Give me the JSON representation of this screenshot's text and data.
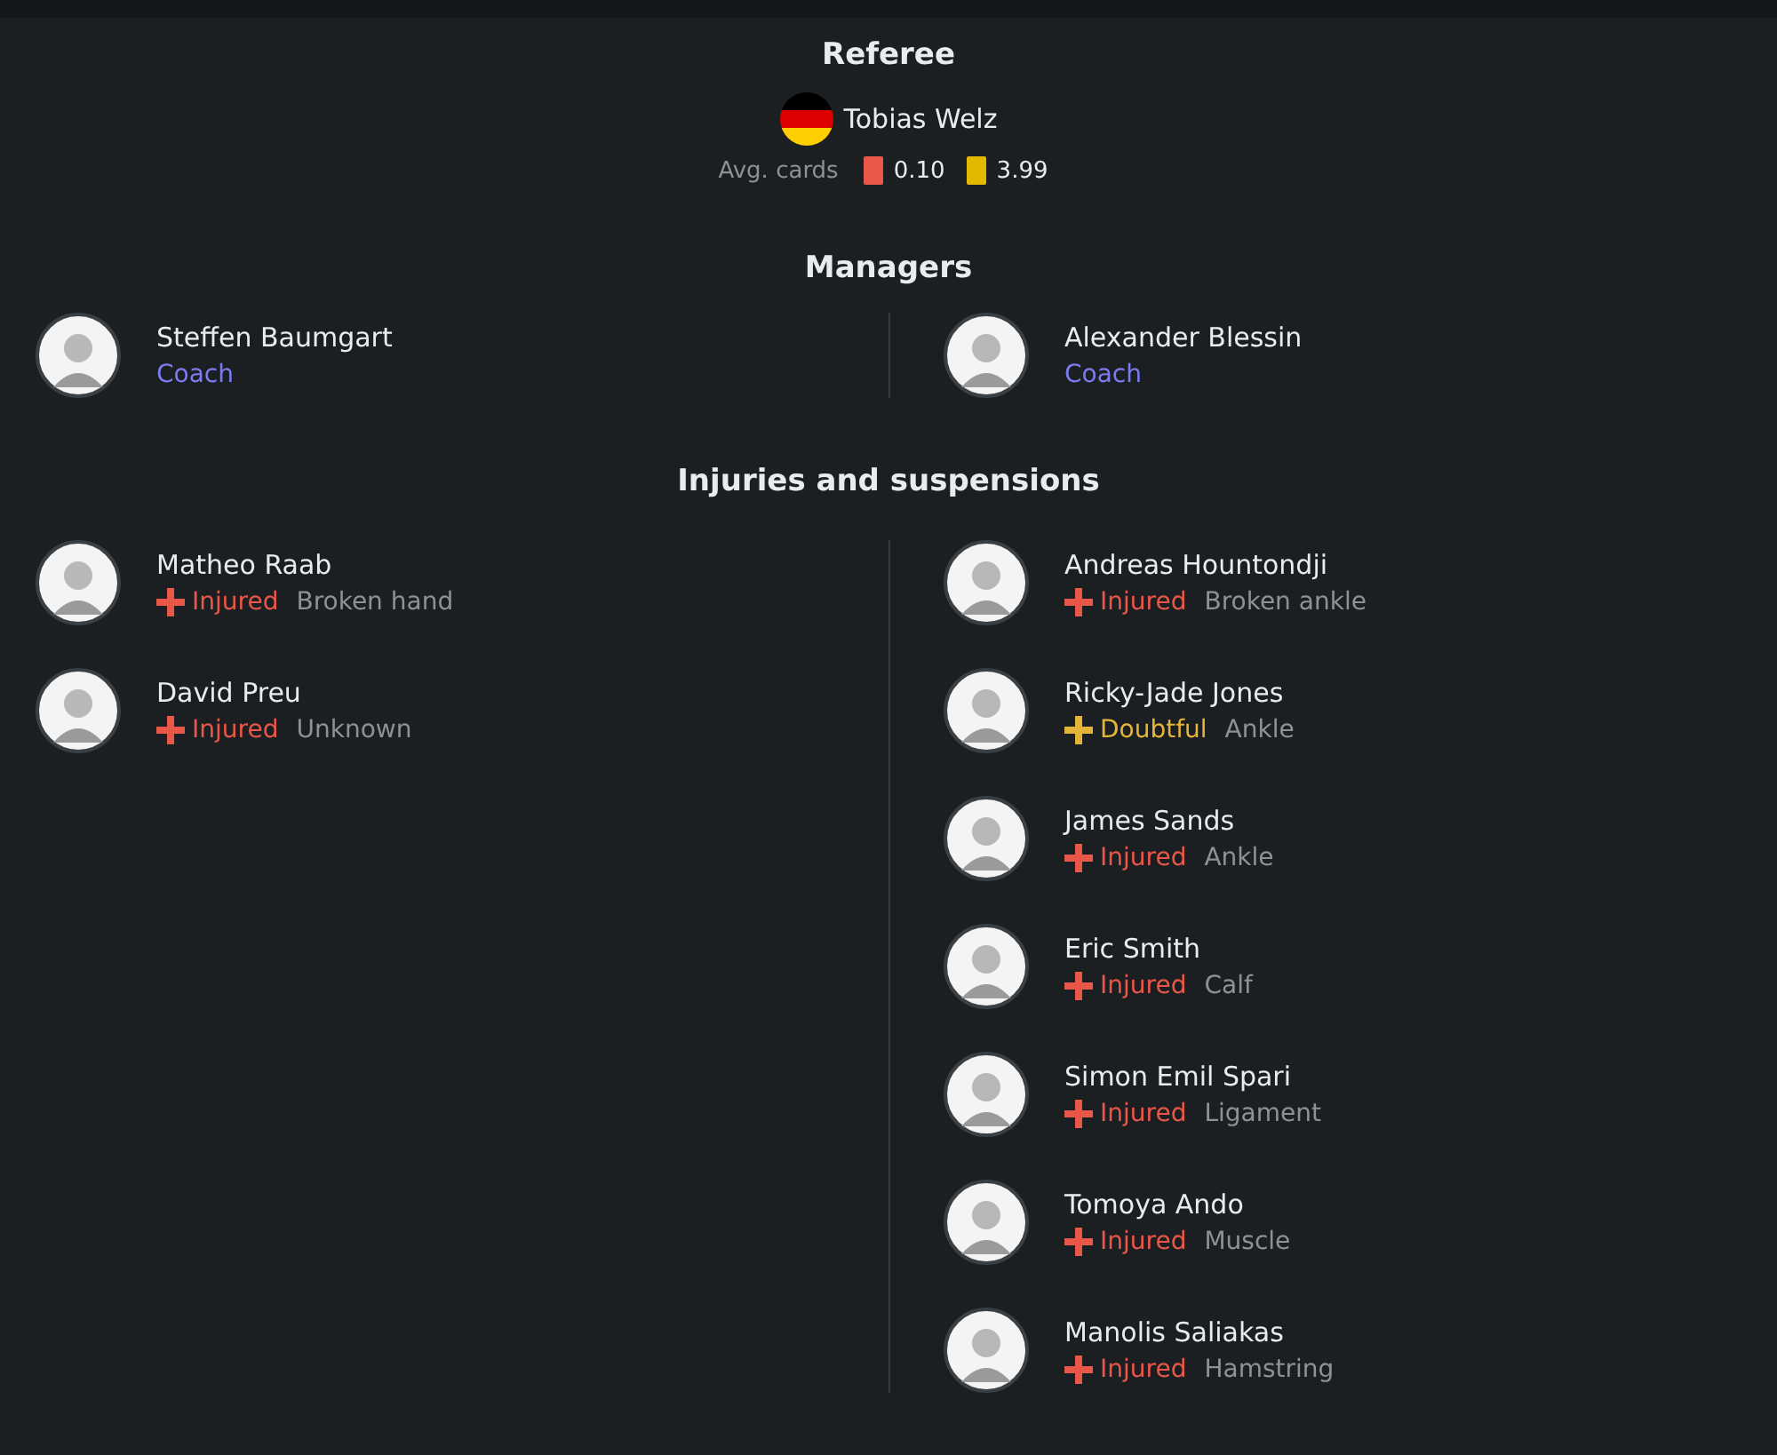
{
  "referee": {
    "title": "Referee",
    "name": "Tobias Welz",
    "avg_label": "Avg. cards",
    "red_cards": "0.10",
    "yellow_cards": "3.99"
  },
  "managers": {
    "title": "Managers",
    "items": [
      {
        "name": "Steffen Baumgart",
        "role": "Coach"
      },
      {
        "name": "Alexander Blessin",
        "role": "Coach"
      }
    ]
  },
  "injuries": {
    "title": "Injuries and suspensions",
    "columns": [
      [
        {
          "name": "Matheo Raab",
          "status": "Injured",
          "kind": "injured",
          "reason": "Broken hand"
        },
        {
          "name": "David Preu",
          "status": "Injured",
          "kind": "injured",
          "reason": "Unknown"
        }
      ],
      [
        {
          "name": "Andreas Hountondji",
          "status": "Injured",
          "kind": "injured",
          "reason": "Broken ankle"
        },
        {
          "name": "Ricky-Jade Jones",
          "status": "Doubtful",
          "kind": "doubtful",
          "reason": "Ankle"
        },
        {
          "name": "James Sands",
          "status": "Injured",
          "kind": "injured",
          "reason": "Ankle"
        },
        {
          "name": "Eric Smith",
          "status": "Injured",
          "kind": "injured",
          "reason": "Calf"
        },
        {
          "name": "Simon Emil Spari",
          "status": "Injured",
          "kind": "injured",
          "reason": "Ligament"
        },
        {
          "name": "Tomoya Ando",
          "status": "Injured",
          "kind": "injured",
          "reason": "Muscle"
        },
        {
          "name": "Manolis Saliakas",
          "status": "Injured",
          "kind": "injured",
          "reason": "Hamstring"
        }
      ]
    ]
  }
}
